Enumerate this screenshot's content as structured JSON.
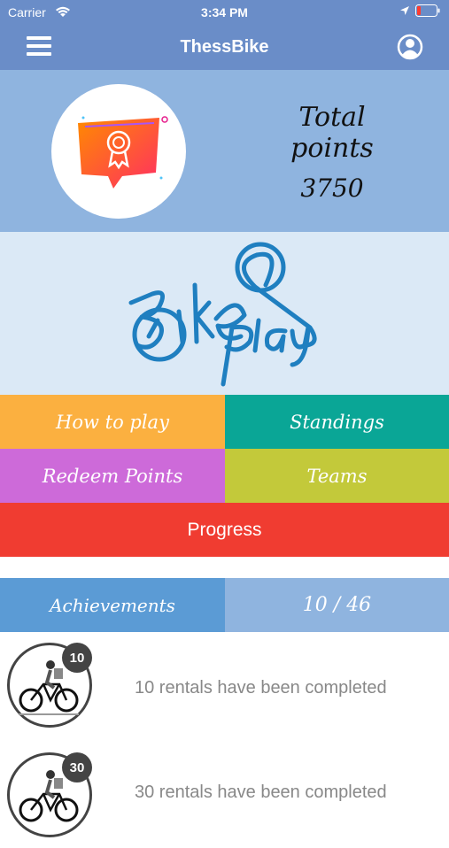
{
  "status_bar": {
    "carrier": "Carrier",
    "time": "3:34 PM"
  },
  "navbar": {
    "title": "ThessBike",
    "menu_icon": "hamburger-menu-icon",
    "profile_icon": "user-profile-icon"
  },
  "points": {
    "label": "Total points",
    "value": "3750",
    "badge_icon": "award-badge-icon"
  },
  "logo": {
    "text": "Bike & play"
  },
  "menu": {
    "how_to_play": "How to play",
    "standings": "Standings",
    "redeem_points": "Redeem Points",
    "teams": "Teams",
    "progress": "Progress"
  },
  "achievements": {
    "label": "Achievements",
    "count": "10 / 46",
    "items": [
      {
        "badge": "10",
        "text": "10 rentals have been completed"
      },
      {
        "badge": "30",
        "text": "30 rentals have been completed"
      }
    ]
  },
  "colors": {
    "nav": "#6a8dc8",
    "points_bg": "#8fb4df",
    "logo_bg": "#dbe9f6",
    "how_to_play": "#fbb040",
    "standings": "#0aa696",
    "redeem": "#cd6ad9",
    "teams": "#c3c93a",
    "progress": "#f03c31",
    "achievements": "#5b9bd5"
  }
}
